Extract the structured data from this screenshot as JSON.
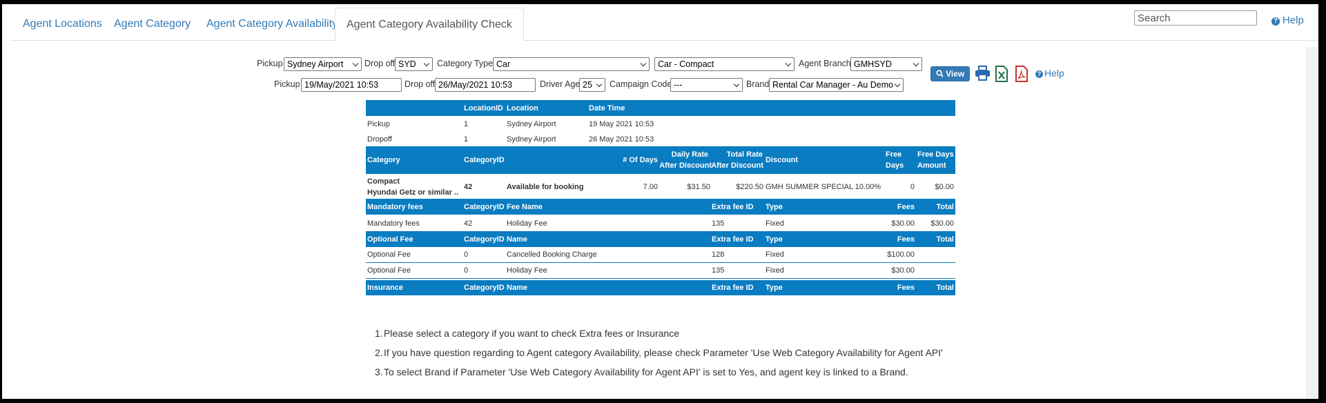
{
  "tabs": [
    {
      "label": "Agent Locations",
      "active": false
    },
    {
      "label": "Agent Category",
      "active": false
    },
    {
      "label": "Agent Category Availability",
      "active": false
    },
    {
      "label": "Agent Category Availability Check",
      "active": true
    }
  ],
  "search": {
    "placeholder": "Search"
  },
  "top_help": "Help",
  "form": {
    "pickup_label": "Pickup",
    "pickup_location": "Sydney Airport",
    "dropoff_label": "Drop off",
    "dropoff_location": "SYD",
    "category_type_label": "Category Type",
    "category_type": "Car",
    "category": "Car - Compact",
    "agent_branch_label": "Agent Branch",
    "agent_branch": "GMHSYD",
    "pickup_date_label": "Pickup",
    "pickup_date": "19/May/2021 10:53",
    "dropoff_date_label": "Drop off",
    "dropoff_date": "26/May/2021 10:53",
    "driver_age_label": "Driver Age",
    "driver_age": "25",
    "campaign_code_label": "Campaign Code",
    "campaign_code": "---",
    "brand_label": "Brand",
    "brand": "Rental Car Manager - Au Demo",
    "view_label": "View",
    "help_label": "Help"
  },
  "icons": {
    "print": "print-icon",
    "excel": "excel-icon",
    "pdf": "pdf-icon",
    "help": "question-circle-icon",
    "view": "search-icon"
  },
  "colors": {
    "header_blue": "#0a7cc1",
    "link_blue": "#337ab7",
    "excel_green": "#1e7145",
    "pdf_red": "#c9302c"
  },
  "locations": {
    "headers": [
      "LocationID",
      "Location",
      "Date Time"
    ],
    "rows": [
      {
        "type": "Pickup",
        "id": "1",
        "location": "Sydney Airport",
        "datetime": "19 May 2021 10:53"
      },
      {
        "type": "Dropoff",
        "id": "1",
        "location": "Sydney Airport",
        "datetime": "26 May 2021 10:53"
      }
    ]
  },
  "categories": {
    "headers": {
      "category": "Category",
      "category_id": "CategoryID",
      "days": "# Of Days",
      "daily_rate_1": "Daily Rate",
      "daily_rate_2": "After Discount",
      "total_rate_1": "Total Rate",
      "total_rate_2": "After Discount",
      "discount": "Discount",
      "free_days_1": "Free",
      "free_days_2": "Days",
      "free_amount_1": "Free Days",
      "free_amount_2": "Amount"
    },
    "rows": [
      {
        "name": "Compact",
        "subname": "Hyundai Getz or similar ..",
        "id": "42",
        "status": "Available for booking",
        "days": "7.00",
        "daily_rate": "$31.50",
        "total_rate": "$220.50",
        "discount": "GMH SUMMER SPECIAL 10.00%",
        "free_days": "0",
        "free_amount": "$0.00"
      }
    ]
  },
  "mandatory_fees": {
    "headers": {
      "section": "Mandatory fees",
      "category_id": "CategoryID",
      "name": "Fee Name",
      "extra_fee_id": "Extra fee ID",
      "type": "Type",
      "fees": "Fees",
      "total": "Total"
    },
    "rows": [
      {
        "section": "Mandatory fees",
        "id": "42",
        "name": "Holiday Fee",
        "extra_fee_id": "135",
        "type": "Fixed",
        "fees": "$30.00",
        "total": "$30.00"
      }
    ]
  },
  "optional_fees": {
    "headers": {
      "section": "Optional Fee",
      "category_id": "CategoryID",
      "name": "Name",
      "extra_fee_id": "Extra fee ID",
      "type": "Type",
      "fees": "Fees",
      "total": "Total"
    },
    "rows": [
      {
        "section": "Optional Fee",
        "id": "0",
        "name": "Cancelled Booking Charge",
        "extra_fee_id": "128",
        "type": "Fixed",
        "fees": "$100.00",
        "total": ""
      },
      {
        "section": "Optional Fee",
        "id": "0",
        "name": "Holiday Fee",
        "extra_fee_id": "135",
        "type": "Fixed",
        "fees": "$30.00",
        "total": ""
      }
    ]
  },
  "insurance": {
    "headers": {
      "section": "Insurance",
      "category_id": "CategoryID",
      "name": "Name",
      "extra_fee_id": "Extra fee ID",
      "type": "Type",
      "fees": "Fees",
      "total": "Total"
    }
  },
  "notes": [
    "Please select a category if you want to check Extra fees or Insurance",
    "If you have question regarding to Agent category Availability, please check Parameter 'Use Web Category Availability for Agent API'",
    "To select Brand if Parameter 'Use Web Category Availability for Agent API' is set to Yes, and agent key is linked to a Brand."
  ]
}
